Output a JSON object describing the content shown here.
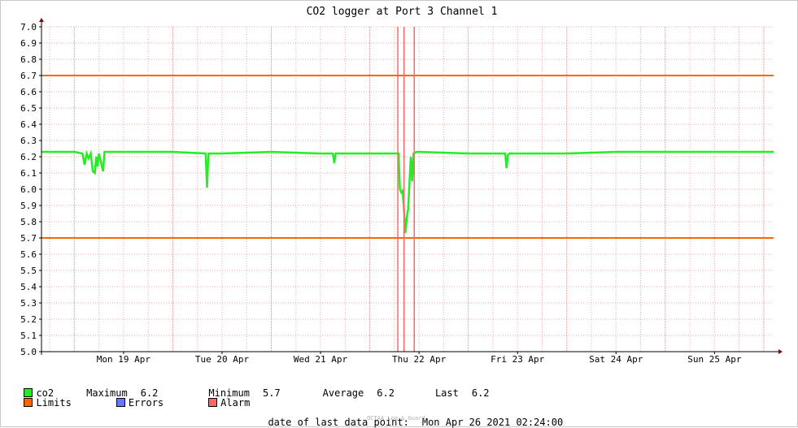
{
  "chart_data": {
    "type": "line",
    "title": "CO2 logger at Port 3 Channel 1",
    "ylim": [
      5.0,
      7.0
    ],
    "y_ticks": [
      "5.0",
      "5.1",
      "5.2",
      "5.3",
      "5.4",
      "5.5",
      "5.6",
      "5.7",
      "5.8",
      "5.9",
      "6.0",
      "6.1",
      "6.2",
      "6.3",
      "6.4",
      "6.5",
      "6.6",
      "6.7",
      "6.8",
      "6.9",
      "7.0"
    ],
    "x_range": [
      "2021-04-18 16:00",
      "2021-04-26 02:24"
    ],
    "x_ticks": [
      {
        "time": "2021-04-19 12:00",
        "label": "Mon 19 Apr"
      },
      {
        "time": "2021-04-20 12:00",
        "label": "Tue 20 Apr"
      },
      {
        "time": "2021-04-21 12:00",
        "label": "Wed 21 Apr"
      },
      {
        "time": "2021-04-22 12:00",
        "label": "Thu 22 Apr"
      },
      {
        "time": "2021-04-23 12:00",
        "label": "Fri 23 Apr"
      },
      {
        "time": "2021-04-24 12:00",
        "label": "Sat 24 Apr"
      },
      {
        "time": "2021-04-25 12:00",
        "label": "Sun 25 Apr"
      }
    ],
    "series": [
      {
        "name": "co2",
        "color": "#22ee22",
        "points": [
          [
            "2021-04-18 16:00",
            6.23
          ],
          [
            "2021-04-19 00:00",
            6.23
          ],
          [
            "2021-04-19 02:00",
            6.22
          ],
          [
            "2021-04-19 02:30",
            6.15
          ],
          [
            "2021-04-19 03:00",
            6.22
          ],
          [
            "2021-04-19 03:30",
            6.19
          ],
          [
            "2021-04-19 04:00",
            6.22
          ],
          [
            "2021-04-19 04:30",
            6.11
          ],
          [
            "2021-04-19 05:00",
            6.1
          ],
          [
            "2021-04-19 05:20",
            6.2
          ],
          [
            "2021-04-19 05:40",
            6.14
          ],
          [
            "2021-04-19 06:00",
            6.22
          ],
          [
            "2021-04-19 07:00",
            6.11
          ],
          [
            "2021-04-19 07:20",
            6.23
          ],
          [
            "2021-04-19 12:00",
            6.23
          ],
          [
            "2021-04-20 00:00",
            6.23
          ],
          [
            "2021-04-20 08:00",
            6.22
          ],
          [
            "2021-04-20 08:20",
            6.01
          ],
          [
            "2021-04-20 08:40",
            6.22
          ],
          [
            "2021-04-20 12:00",
            6.22
          ],
          [
            "2021-04-21 00:00",
            6.23
          ],
          [
            "2021-04-21 12:00",
            6.22
          ],
          [
            "2021-04-21 15:00",
            6.22
          ],
          [
            "2021-04-21 15:20",
            6.16
          ],
          [
            "2021-04-21 15:40",
            6.22
          ],
          [
            "2021-04-22 00:00",
            6.22
          ],
          [
            "2021-04-22 07:00",
            6.22
          ],
          [
            "2021-04-22 07:20",
            6.0
          ],
          [
            "2021-04-22 07:40",
            5.98
          ],
          [
            "2021-04-22 08:00",
            5.99
          ],
          [
            "2021-04-22 08:20",
            5.88
          ],
          [
            "2021-04-22 08:40",
            5.73
          ],
          [
            "2021-04-22 09:00",
            5.82
          ],
          [
            "2021-04-22 09:20",
            5.88
          ],
          [
            "2021-04-22 09:40",
            6.04
          ],
          [
            "2021-04-22 10:00",
            6.2
          ],
          [
            "2021-04-22 10:20",
            6.05
          ],
          [
            "2021-04-22 10:40",
            6.22
          ],
          [
            "2021-04-22 11:20",
            6.23
          ],
          [
            "2021-04-22 12:00",
            6.23
          ],
          [
            "2021-04-23 00:00",
            6.22
          ],
          [
            "2021-04-23 09:00",
            6.22
          ],
          [
            "2021-04-23 09:20",
            6.13
          ],
          [
            "2021-04-23 09:40",
            6.21
          ],
          [
            "2021-04-23 10:00",
            6.22
          ],
          [
            "2021-04-23 12:00",
            6.22
          ],
          [
            "2021-04-24 00:00",
            6.22
          ],
          [
            "2021-04-24 12:00",
            6.23
          ],
          [
            "2021-04-25 00:00",
            6.23
          ],
          [
            "2021-04-25 12:00",
            6.23
          ],
          [
            "2021-04-26 00:00",
            6.23
          ],
          [
            "2021-04-26 02:24",
            6.23
          ]
        ]
      }
    ],
    "limits": {
      "color": "#ff6600",
      "values": [
        6.7,
        5.7
      ]
    },
    "alarm": {
      "color": "#ff6666",
      "times": [
        "2021-04-22 06:50",
        "2021-04-22 08:20",
        "2021-04-22 10:50"
      ]
    },
    "grid": true
  },
  "legend": {
    "co2_label": "co2",
    "max_text": "Maximum",
    "max_value": "6.2",
    "min_text": "Minimum",
    "min_value": "5.7",
    "avg_text": "Average",
    "avg_value": "6.2",
    "last_text": "Last",
    "last_value": "6.2",
    "limits_label": "Limits",
    "errors_label": "Errors",
    "alarm_label": "Alarm",
    "co2_color": "#22ee22",
    "limits_color": "#ff6600",
    "errors_color": "#6677ff",
    "alarm_color": "#ff6666"
  },
  "footer": {
    "last_point_label": "date of last data point:",
    "last_point_value": "Mon Apr 26 2021 02:24:00",
    "credit": "OCTAA Log & Guard"
  }
}
